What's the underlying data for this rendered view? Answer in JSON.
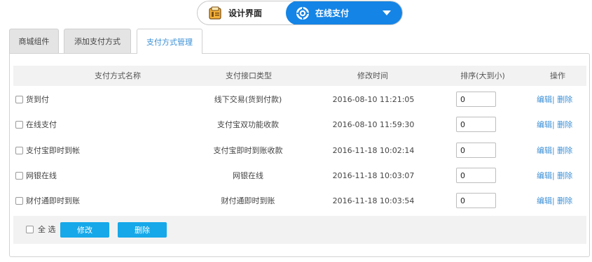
{
  "switcher": {
    "design_label": "设计界面",
    "current_label": "在线支付",
    "icons": {
      "design": "wizard-icon",
      "current": "gear-icon",
      "dropdown": "chevron-down-icon"
    }
  },
  "tabs": [
    {
      "label": "商城组件",
      "active": false
    },
    {
      "label": "添加支付方式",
      "active": false
    },
    {
      "label": "支付方式管理",
      "active": true
    }
  ],
  "table": {
    "headers": [
      "支付方式名称",
      "支付接口类型",
      "修改时间",
      "排序(大到小)",
      "操作"
    ],
    "rows": [
      {
        "name": "货到付",
        "type": "线下交易(货到付款)",
        "time": "2016-08-10 11:21:05",
        "sort": "0",
        "checked": false
      },
      {
        "name": "在线支付",
        "type": "支付宝双功能收款",
        "time": "2016-08-10 11:59:30",
        "sort": "0",
        "checked": false
      },
      {
        "name": "支付宝即时到帐",
        "type": "支付宝即时到账收款",
        "time": "2016-11-18 10:02:14",
        "sort": "0",
        "checked": false
      },
      {
        "name": "网银在线",
        "type": "网银在线",
        "time": "2016-11-18 10:03:07",
        "sort": "0",
        "checked": false
      },
      {
        "name": "财付通即时到账",
        "type": "财付通即时到账",
        "time": "2016-11-18 10:03:54",
        "sort": "0",
        "checked": false
      }
    ],
    "row_actions": {
      "edit": "编辑",
      "separator": "|",
      "delete": "删除"
    }
  },
  "footer": {
    "select_all_label": "全 选",
    "modify_button": "修改",
    "delete_button": "删除"
  },
  "colors": {
    "accent_blue": "#1484e6",
    "button_blue": "#16a8e9",
    "link_blue": "#3d90d6",
    "header_gray": "#f2f2f2"
  }
}
